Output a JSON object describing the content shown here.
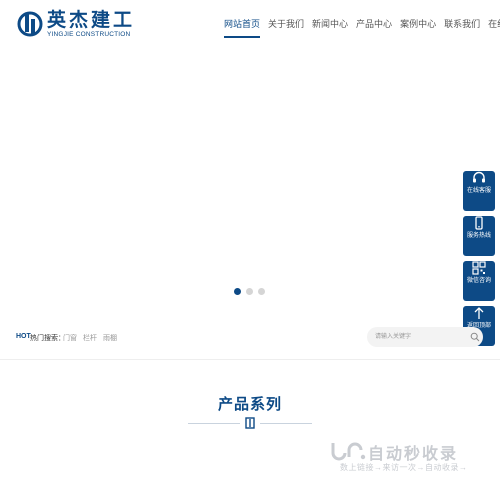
{
  "brand": {
    "name_cn": "英杰建工",
    "name_en": "YINGJIE CONSTRUCTION",
    "color": "#0d4a86"
  },
  "nav": {
    "items": [
      {
        "label": "网站首页",
        "active": true
      },
      {
        "label": "关于我们",
        "active": false
      },
      {
        "label": "新闻中心",
        "active": false
      },
      {
        "label": "产品中心",
        "active": false
      },
      {
        "label": "案例中心",
        "active": false
      },
      {
        "label": "联系我们",
        "active": false
      },
      {
        "label": "在线留言",
        "active": false
      }
    ]
  },
  "banner": {
    "dots": [
      {
        "active": true
      },
      {
        "active": false
      },
      {
        "active": false
      }
    ]
  },
  "side_bar": {
    "items": [
      {
        "label": "在线客服",
        "icon": "headset-icon"
      },
      {
        "label": "服务热线",
        "icon": "phone-icon"
      },
      {
        "label": "微信咨询",
        "icon": "qrcode-icon"
      },
      {
        "label": "返回顶部",
        "icon": "arrow-up-icon"
      }
    ]
  },
  "hot_search": {
    "label": "HOT",
    "sub_label": "热门搜索：",
    "keywords": [
      "门窗",
      "栏杆",
      "雨棚"
    ],
    "placeholder": "请输入关键字"
  },
  "products": {
    "title": "产品系列"
  },
  "watermark": {
    "main": "自动秒收录",
    "sub": "数上链接→来访一次→自动收录→"
  }
}
